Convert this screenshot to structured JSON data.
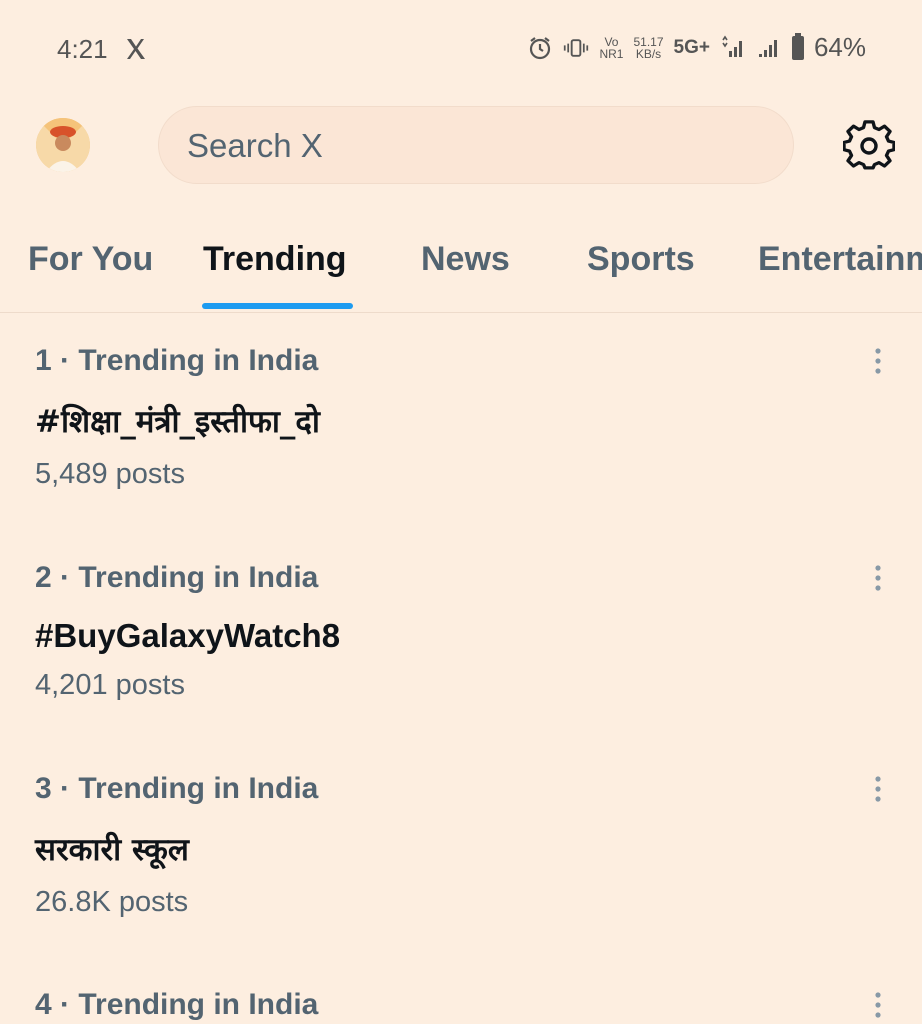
{
  "status_bar": {
    "time": "4:21",
    "network_small_top": "Vo",
    "network_small_bottom": "NR1",
    "speed_value": "51.17",
    "speed_unit": "KB/s",
    "network_type": "5G+",
    "battery": "64%"
  },
  "header": {
    "search_placeholder": "Search X"
  },
  "tabs": [
    {
      "label": "For You",
      "active": false
    },
    {
      "label": "Trending",
      "active": true
    },
    {
      "label": "News",
      "active": false
    },
    {
      "label": "Sports",
      "active": false
    },
    {
      "label": "Entertainment",
      "active": false
    }
  ],
  "trends": [
    {
      "meta": "1 · Trending in India",
      "name": "#शिक्षा_मंत्री_इस्तीफा_दो",
      "count": "5,489 posts"
    },
    {
      "meta": "2 · Trending in India",
      "name": "#BuyGalaxyWatch8",
      "count": "4,201 posts"
    },
    {
      "meta": "3 · Trending in India",
      "name": "सरकारी स्कूल",
      "count": "26.8K posts"
    },
    {
      "meta": "4 · Trending in India",
      "name": "",
      "count": ""
    }
  ],
  "colors": {
    "background": "#fdeee0",
    "accent": "#1d9bf0",
    "secondary_text": "#536471",
    "primary_text": "#0f1419"
  }
}
